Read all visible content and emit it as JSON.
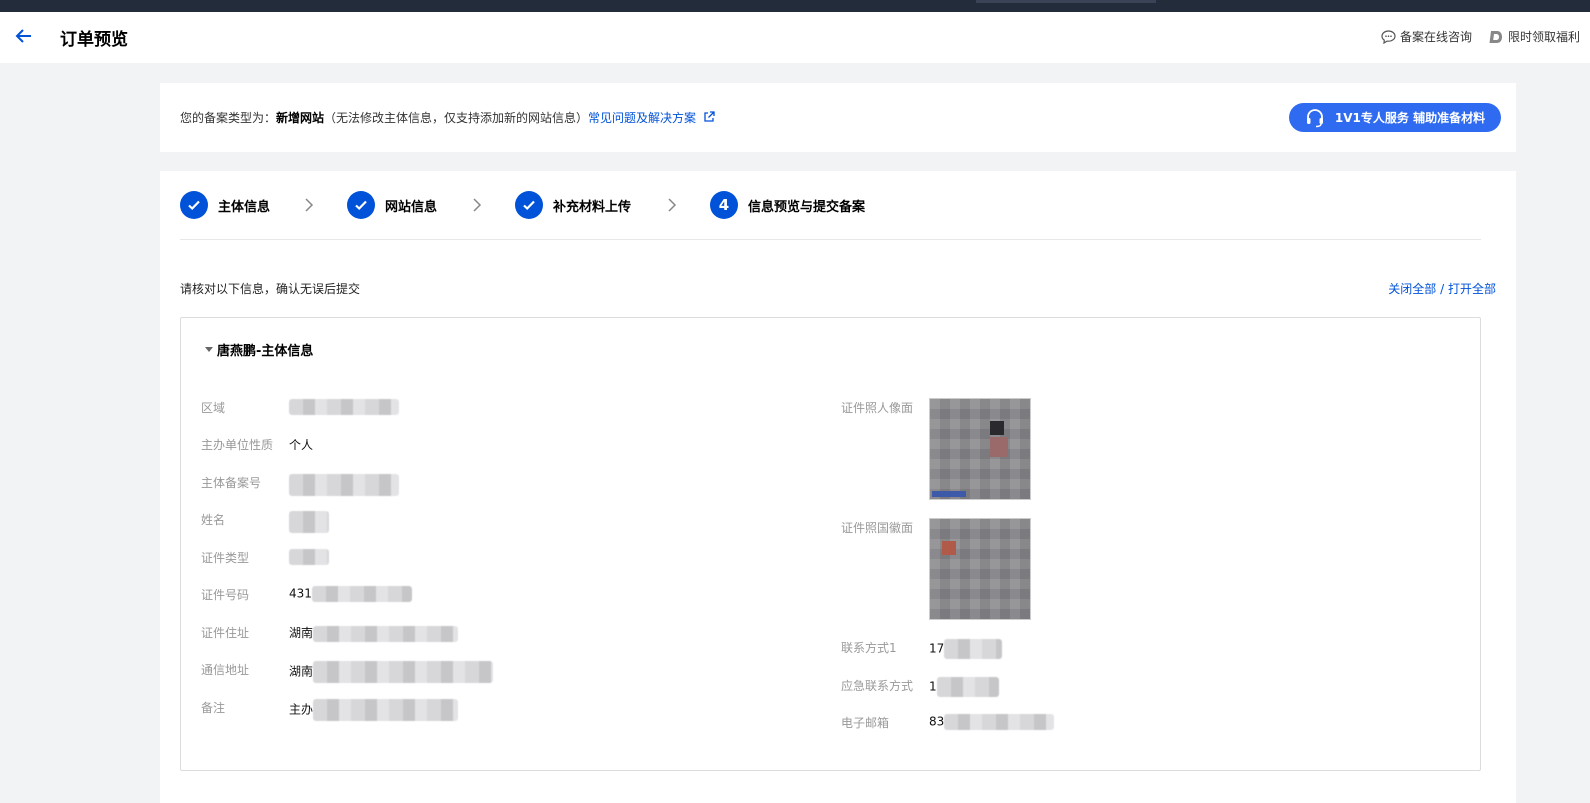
{
  "header": {
    "title": "订单预览",
    "links": [
      {
        "icon": "chat-icon",
        "label": "备案在线咨询"
      },
      {
        "icon": "brand-logo-icon",
        "label": "限时领取福利"
      }
    ]
  },
  "notice": {
    "prefix": "您的备案类型为：",
    "type": "新增网站",
    "desc": "（无法修改主体信息，仅支持添加新的网站信息）",
    "link": "常见问题及解决方案"
  },
  "service_button": "1V1专人服务 辅助准备材料",
  "steps": [
    {
      "label": "主体信息",
      "status": "done"
    },
    {
      "label": "网站信息",
      "status": "done"
    },
    {
      "label": "补充材料上传",
      "status": "done"
    },
    {
      "number": "4",
      "label": "信息预览与提交备案",
      "status": "current"
    }
  ],
  "instruction": "请核对以下信息，确认无误后提交",
  "toggle": {
    "close_all": "关闭全部",
    "sep": " / ",
    "open_all": "打开全部"
  },
  "card": {
    "title": "唐燕鹏-主体信息",
    "left_fields": [
      {
        "label": "区域",
        "value": ""
      },
      {
        "label": "主办单位性质",
        "value": "个人"
      },
      {
        "label": "主体备案号",
        "value": ""
      },
      {
        "label": "姓名",
        "value": ""
      },
      {
        "label": "证件类型",
        "value": ""
      },
      {
        "label": "证件号码",
        "value": "431"
      },
      {
        "label": "证件住址",
        "value": "湖南"
      },
      {
        "label": "通信地址",
        "value": "湖南"
      },
      {
        "label": "备注",
        "value": "主办"
      }
    ],
    "right_fields": [
      {
        "label": "证件照人像面"
      },
      {
        "label": "证件照国徽面"
      },
      {
        "label": "联系方式1",
        "value": "17"
      },
      {
        "label": "应急联系方式",
        "value": "1"
      },
      {
        "label": "电子邮箱",
        "value": "83"
      }
    ]
  }
}
